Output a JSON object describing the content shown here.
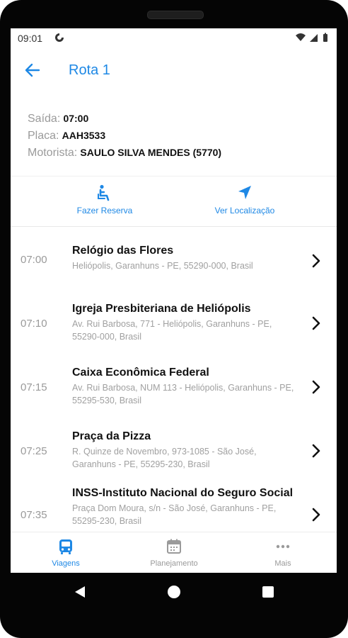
{
  "status_bar": {
    "time": "09:01"
  },
  "header": {
    "title": "Rota 1"
  },
  "info": {
    "saida_label": "Saída:",
    "saida_value": "07:00",
    "placa_label": "Placa:",
    "placa_value": "AAH3533",
    "motorista_label": "Motorista:",
    "motorista_value": "SAULO SILVA MENDES (5770)"
  },
  "actions": {
    "reserve_label": "Fazer Reserva",
    "location_label": "Ver Localização"
  },
  "stops": [
    {
      "time": "07:00",
      "name": "Relógio das Flores",
      "address": "Heliópolis, Garanhuns - PE, 55290-000, Brasil"
    },
    {
      "time": "07:10",
      "name": "Igreja Presbiteriana de Heliópolis",
      "address": "Av. Rui Barbosa, 771 - Heliópolis, Garanhuns - PE, 55290-000, Brasil"
    },
    {
      "time": "07:15",
      "name": "Caixa Econômica Federal",
      "address": "Av. Rui Barbosa, NUM 113 - Heliópolis, Garanhuns - PE, 55295-530, Brasil"
    },
    {
      "time": "07:25",
      "name": "Praça da Pizza",
      "address": "R. Quinze de Novembro, 973-1085 - São José, Garanhuns - PE, 55295-230, Brasil"
    },
    {
      "time": "07:35",
      "name": "INSS-Instituto Nacional do Seguro Social",
      "address": "Praça Dom Moura, s/n - São José, Garanhuns - PE, 55295-230, Brasil"
    }
  ],
  "bottom_nav": {
    "items": [
      {
        "label": "Viagens",
        "icon": "bus-icon"
      },
      {
        "label": "Planejamento",
        "icon": "calendar-icon"
      },
      {
        "label": "Mais",
        "icon": "more-dots-icon"
      }
    ]
  },
  "colors": {
    "accent": "#1e88e5",
    "muted": "#9a9a9a",
    "text": "#111111"
  }
}
